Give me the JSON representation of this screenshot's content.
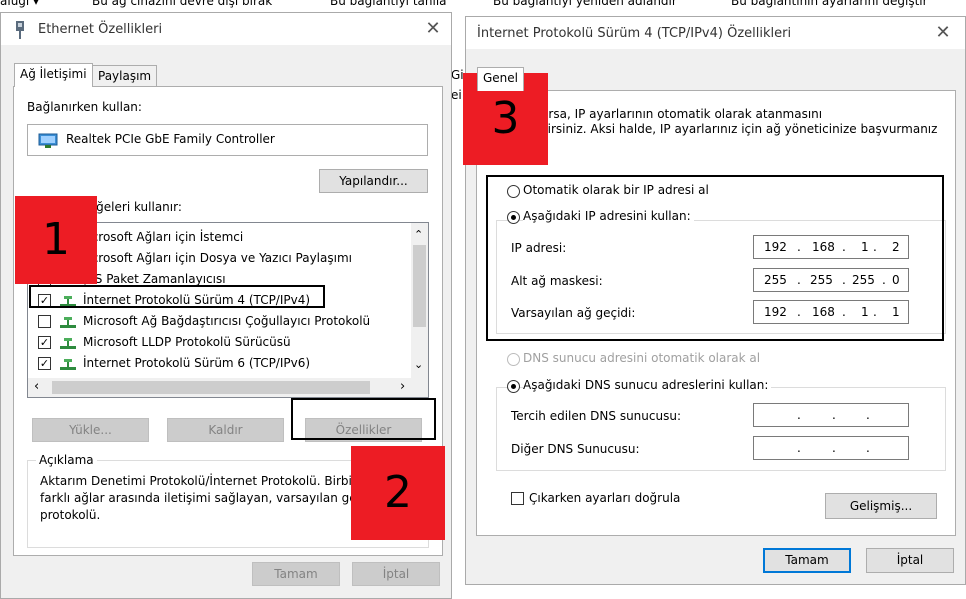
{
  "background": {
    "top_fragments": [
      "alugi ▾",
      "Bu ağ cihazını devre dışı bırak",
      "Bu bağlantıyı tanıla",
      "Bu bağlantıyı yeniden adlandır",
      "Bu bağlantının ayarlarını değiştir"
    ],
    "partial_labels": [
      "Gi",
      "ei"
    ]
  },
  "eth": {
    "title": "Ethernet Özellikleri",
    "tabs": [
      "Ağ İletişimi",
      "Paylaşım"
    ],
    "connect_using_label": "Bağlanırken kullan:",
    "adapter_name": "Realtek PCIe GbE Family Controller",
    "configure_button": "Yapılandır...",
    "items_label": "Aşağıdaki öğeleri kullanır:",
    "items": [
      {
        "label": "Microsoft Ağları için İstemci",
        "checked": true
      },
      {
        "label": "Microsoft Ağları için Dosya ve Yazıcı Paylaşımı",
        "checked": true
      },
      {
        "label": "QoS Paket Zamanlayıcısı",
        "checked": true
      },
      {
        "label": "İnternet Protokolü Sürüm 4 (TCP/IPv4)",
        "checked": true
      },
      {
        "label": "Microsoft Ağ Bağdaştırıcısı Çoğullayıcı Protokolü",
        "checked": false
      },
      {
        "label": "Microsoft LLDP Protokolü Sürücüsü",
        "checked": true
      },
      {
        "label": "İnternet Protokolü Sürüm 6 (TCP/IPv6)",
        "checked": true
      }
    ],
    "install_button": "Yükle...",
    "uninstall_button": "Kaldır",
    "properties_button": "Özellikler",
    "description_label": "Açıklama",
    "description_lines": [
      "Aktarım Denetimi Protokolü/İnternet Protokolü. Birbir",
      "farklı ağlar arasında iletişimi sağlayan, varsayılan gen",
      "protokolü."
    ],
    "ok_button": "Tamam",
    "cancel_button": "İptal"
  },
  "ipv4": {
    "title": "İnternet Protokolü Sürüm 4 (TCP/IPv4) Özellikleri",
    "tab": "Genel",
    "intro_lines": [
      "destekliyorsa, IP ayarlarının otomatik olarak atanmasını",
      "sağlayabilirsiniz. Aksi halde, IP ayarlarınız için ağ yöneticinize başvurmanız"
    ],
    "auto_ip_label": "Otomatik olarak bir IP adresi al",
    "manual_ip_label": "Aşağıdaki IP adresini kullan:",
    "ip_label": "IP adresi:",
    "ip_value": [
      "192",
      "168",
      "1",
      "2"
    ],
    "mask_label": "Alt ağ maskesi:",
    "mask_value": [
      "255",
      "255",
      "255",
      "0"
    ],
    "gateway_label": "Varsayılan ağ geçidi:",
    "gateway_value": [
      "192",
      "168",
      "1",
      "1"
    ],
    "auto_dns_label": "DNS sunucu adresini otomatik olarak al",
    "manual_dns_label": "Aşağıdaki DNS sunucu adreslerini kullan:",
    "preferred_dns_label": "Tercih edilen DNS sunucusu:",
    "alternate_dns_label": "Diğer DNS Sunucusu:",
    "dot": ".",
    "validate_label": "Çıkarken ayarları doğrula",
    "advanced_button": "Gelişmiş...",
    "ok_button": "Tamam",
    "cancel_button": "İptal"
  },
  "annotations": {
    "step1": "1",
    "step2": "2",
    "step3": "3"
  },
  "colors": {
    "annotation_red": "#ed1c24",
    "focus_blue": "#0078d7",
    "window_bg": "#f0f0f0"
  }
}
